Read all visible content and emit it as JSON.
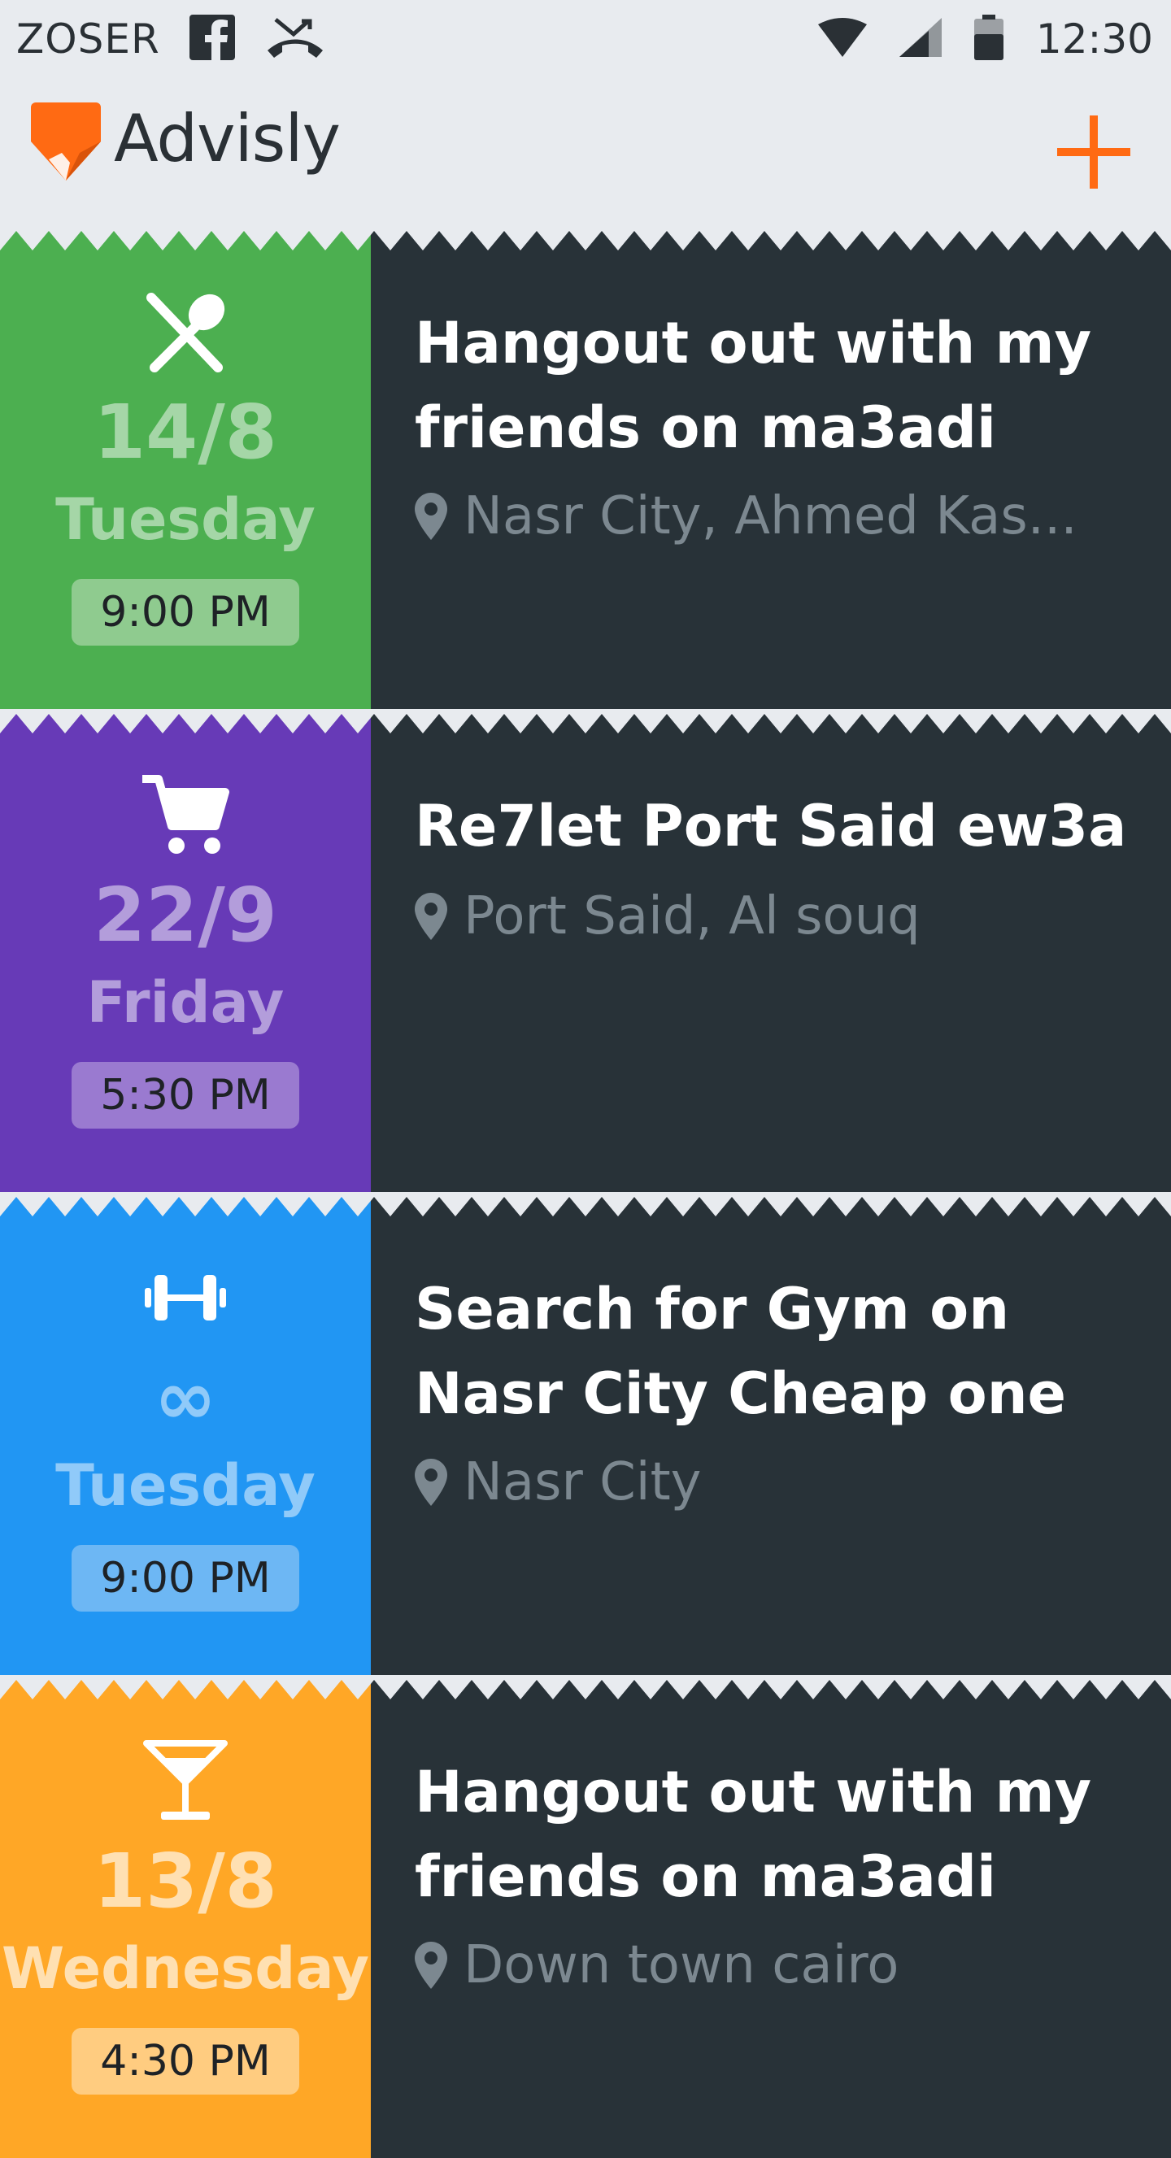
{
  "status_bar": {
    "carrier": "ZOSER",
    "time": "12:30",
    "icons": [
      "facebook-icon",
      "missed-call-icon",
      "wifi-icon",
      "signal-icon",
      "battery-icon"
    ]
  },
  "app_bar": {
    "title": "Advisly",
    "logo_color": "#FF6A13",
    "add_color": "#FF6A13"
  },
  "events": [
    {
      "category_icon": "restaurant-icon",
      "color": "#4CAF50",
      "text_color": "#A5D6A7",
      "badge_color": "#8FCB8F",
      "date": "14/8",
      "day": "Tuesday",
      "time": "9:00 PM",
      "title": "Hangout out with my friends on ma3adi",
      "location": "Nasr City, Ahmed Kas..."
    },
    {
      "category_icon": "shopping-cart-icon",
      "color": "#673AB7",
      "text_color": "#B39DDB",
      "badge_color": "#9A7AD0",
      "date": "22/9",
      "day": "Friday",
      "time": "5:30 PM",
      "title": "Re7let Port Said ew3a",
      "location": "Port Said, Al souq"
    },
    {
      "category_icon": "dumbbell-icon",
      "color": "#2196F3",
      "text_color": "#90CAF9",
      "badge_color": "#6DB7F4",
      "date": "∞",
      "day": "Tuesday",
      "time": "9:00 PM",
      "title": "Search for Gym on Nasr City Cheap one",
      "location": "Nasr City"
    },
    {
      "category_icon": "cocktail-icon",
      "color": "#FFA726",
      "text_color": "#FFE0B2",
      "badge_color": "#FFCC80",
      "date": "13/8",
      "day": "Wednesday",
      "time": "4:30 PM",
      "title": "Hangout out with my friends on ma3adi",
      "location": "Down town cairo"
    }
  ]
}
